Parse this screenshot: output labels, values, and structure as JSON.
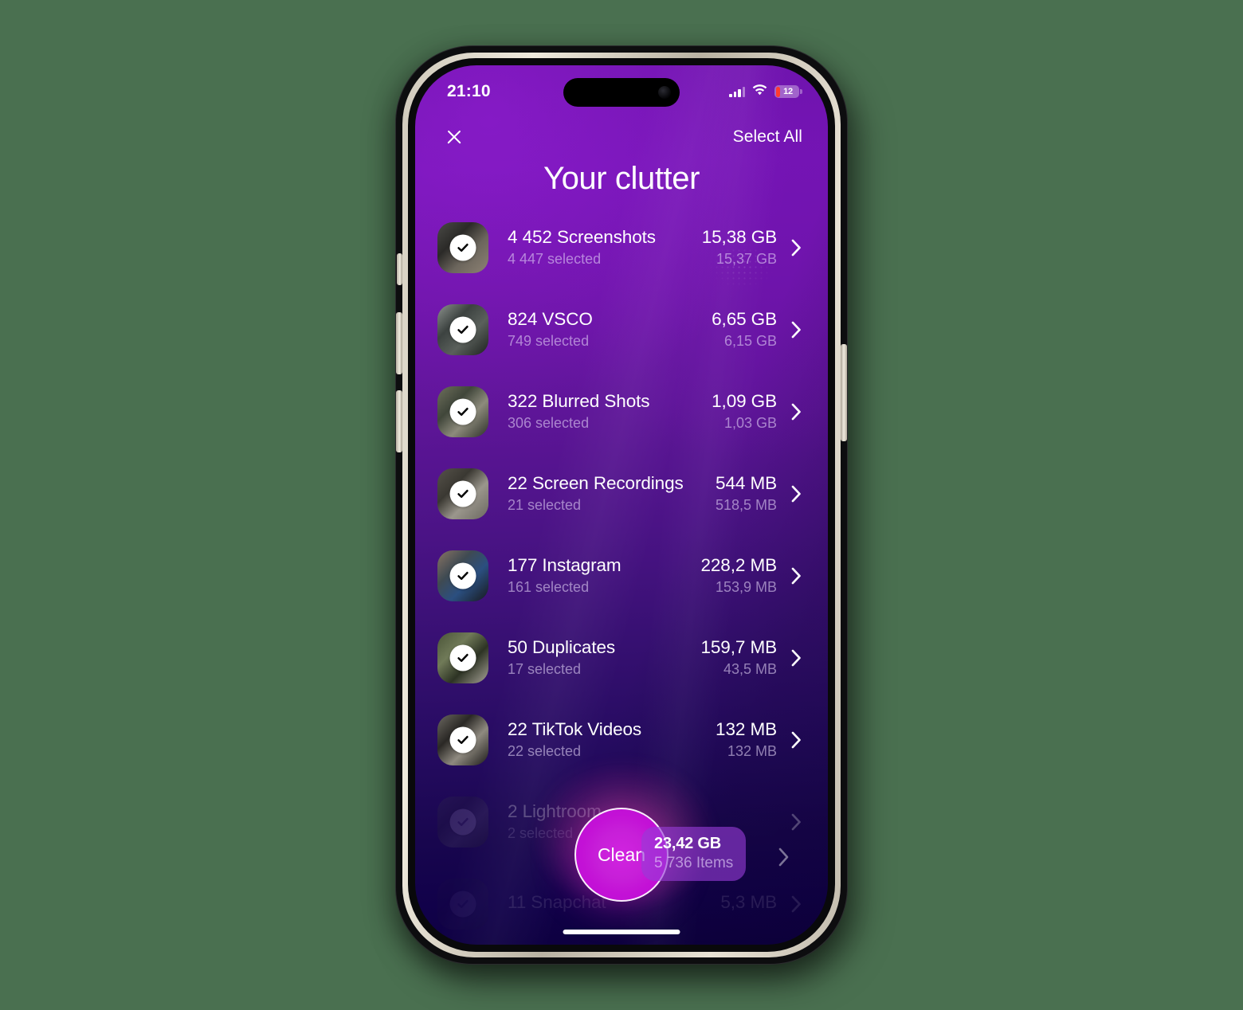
{
  "background_color": "#4a7050",
  "status_bar": {
    "time": "21:10",
    "cellular_icon": "cellular-bars-icon",
    "wifi_icon": "wifi-icon",
    "battery_level": "12",
    "battery_low_color": "#ff3b30"
  },
  "nav": {
    "close_icon": "close-icon",
    "select_all_label": "Select All"
  },
  "header": {
    "title": "Your clutter"
  },
  "list": [
    {
      "title": "4 452 Screenshots",
      "subtitle": "4 447 selected",
      "size": "15,38 GB",
      "size_selected": "15,37 GB",
      "checked": true,
      "thumb_colors": [
        "#4a4a46",
        "#2b2a28",
        "#6b655c",
        "#8d8274"
      ]
    },
    {
      "title": "824 VSCO",
      "subtitle": "749 selected",
      "size": "6,65 GB",
      "size_selected": "6,15 GB",
      "checked": true,
      "thumb_colors": [
        "#8e948f",
        "#3c4240",
        "#5a605b",
        "#1d211f"
      ]
    },
    {
      "title": "322 Blurred Shots",
      "subtitle": "306 selected",
      "size": "1,09 GB",
      "size_selected": "1,03 GB",
      "checked": true,
      "thumb_colors": [
        "#6e705c",
        "#40463a",
        "#8d8b7c",
        "#2c2f28"
      ]
    },
    {
      "title": "22 Screen Recordings",
      "subtitle": "21 selected",
      "size": "544 MB",
      "size_selected": "518,5 MB",
      "checked": true,
      "thumb_colors": [
        "#56524a",
        "#3a3832",
        "#9a968c",
        "#6b6860"
      ]
    },
    {
      "title": "177 Instagram",
      "subtitle": "161 selected",
      "size": "228,2 MB",
      "size_selected": "153,9 MB",
      "checked": true,
      "thumb_colors": [
        "#8a7464",
        "#3f4a52",
        "#2b4f80",
        "#17191c"
      ]
    },
    {
      "title": "50 Duplicates",
      "subtitle": "17 selected",
      "size": "159,7 MB",
      "size_selected": "43,5 MB",
      "checked": true,
      "thumb_colors": [
        "#4a5438",
        "#707a58",
        "#2d3324",
        "#a8a398"
      ]
    },
    {
      "title": "22 TikTok Videos",
      "subtitle": "22 selected",
      "size": "132 MB",
      "size_selected": "132 MB",
      "checked": true,
      "thumb_colors": [
        "#6d6a62",
        "#2a2825",
        "#8f8a80",
        "#1b1a18"
      ]
    },
    {
      "title": "2 Lightroom",
      "subtitle": "2 selected",
      "size": "",
      "size_selected": "",
      "checked": true,
      "thumb_colors": [
        "#3a3650",
        "#242038",
        "#4b4560",
        "#1a1726"
      ]
    },
    {
      "title": "11 Snapchat",
      "subtitle": "",
      "size": "5,3 MB",
      "size_selected": "",
      "checked": true,
      "thumb_colors": [
        "#2a2548",
        "#201c3a",
        "#352f55",
        "#15122a"
      ]
    }
  ],
  "clean_bar": {
    "clean_label": "Clean",
    "summary_size": "23,42 GB",
    "summary_items": "5 736 Items",
    "accent_color": "#c71fd8",
    "badge_color": "#963cd7"
  },
  "chevron_icon": "chevron-right-icon",
  "home_indicator": "home-indicator"
}
